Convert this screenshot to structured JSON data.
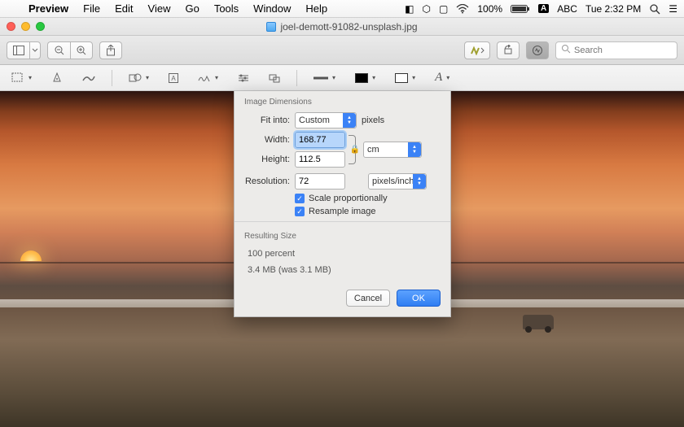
{
  "menubar": {
    "app": "Preview",
    "items": [
      "File",
      "Edit",
      "View",
      "Go",
      "Tools",
      "Window",
      "Help"
    ],
    "battery": "100%",
    "input": "ABC",
    "clock": "Tue 2:32 PM"
  },
  "window": {
    "title": "joel-demott-91082-unsplash.jpg"
  },
  "toolbar": {
    "search_placeholder": "Search"
  },
  "dialog": {
    "section_dimensions": "Image Dimensions",
    "fit_into_label": "Fit into:",
    "fit_into_value": "Custom",
    "fit_into_unit": "pixels",
    "width_label": "Width:",
    "width_value": "168.77",
    "height_label": "Height:",
    "height_value": "112.5",
    "wh_unit": "cm",
    "resolution_label": "Resolution:",
    "resolution_value": "72",
    "resolution_unit": "pixels/inch",
    "scale_label": "Scale proportionally",
    "resample_label": "Resample image",
    "section_result": "Resulting Size",
    "result_percent": "100 percent",
    "result_size": "3.4 MB (was 3.1 MB)",
    "cancel": "Cancel",
    "ok": "OK"
  }
}
